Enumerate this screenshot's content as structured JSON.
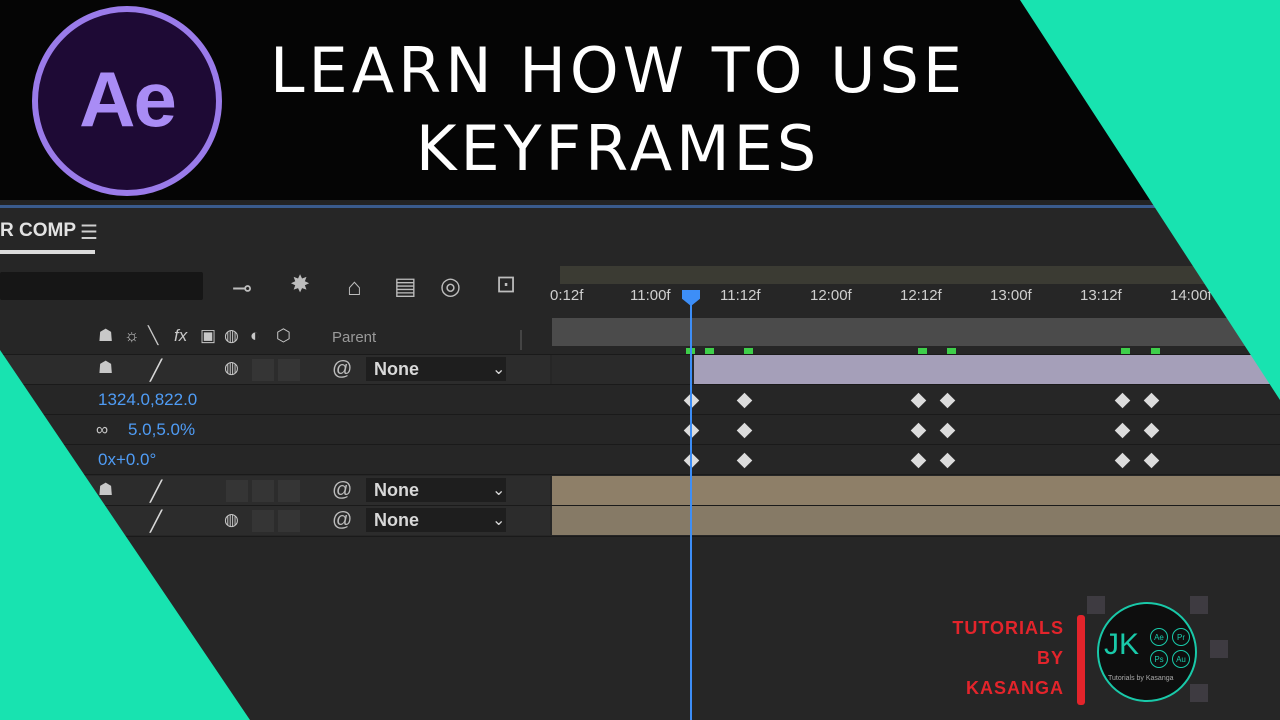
{
  "app_icon": {
    "text": "Ae",
    "name": "after-effects-logo"
  },
  "title": {
    "line1": "LEARN HOW TO USE",
    "line2": "KEYFRAMES"
  },
  "panel": {
    "tab_label": "R COMP",
    "menu_icon": "hamburger-menu-icon"
  },
  "toolbar_icons": [
    "comp-flowchart-icon",
    "draft-3d-icon",
    "shy-layers-icon",
    "frame-blending-icon",
    "motion-blur-icon",
    "graph-editor-icon"
  ],
  "column_header": {
    "parent_label": "Parent"
  },
  "time_ruler": {
    "ticks": [
      "0:12f",
      "11:00f",
      "11:12f",
      "12:00f",
      "12:12f",
      "13:00f",
      "13:12f",
      "14:00f"
    ]
  },
  "layers": [
    {
      "parent": "None"
    },
    {
      "parent": "None"
    },
    {
      "parent": "None"
    }
  ],
  "properties": {
    "position": "1324.0,822.0",
    "scale": "5.0,5.0%",
    "rotation": "0x+0.0°"
  },
  "branding": {
    "line1": "TUTORIALS",
    "line2": "BY",
    "line3": "KASANGA",
    "logo_text": "JK",
    "badges": [
      "Ae",
      "Pr",
      "Ps",
      "Au"
    ],
    "caption": "Tutorials by Kasanga"
  },
  "colors": {
    "accent_teal": "#18e3b0",
    "ae_purple": "#9a7bea",
    "playhead_blue": "#3d8ef7",
    "brand_red": "#e3242b",
    "keyframe_green": "#3ecf4a"
  }
}
